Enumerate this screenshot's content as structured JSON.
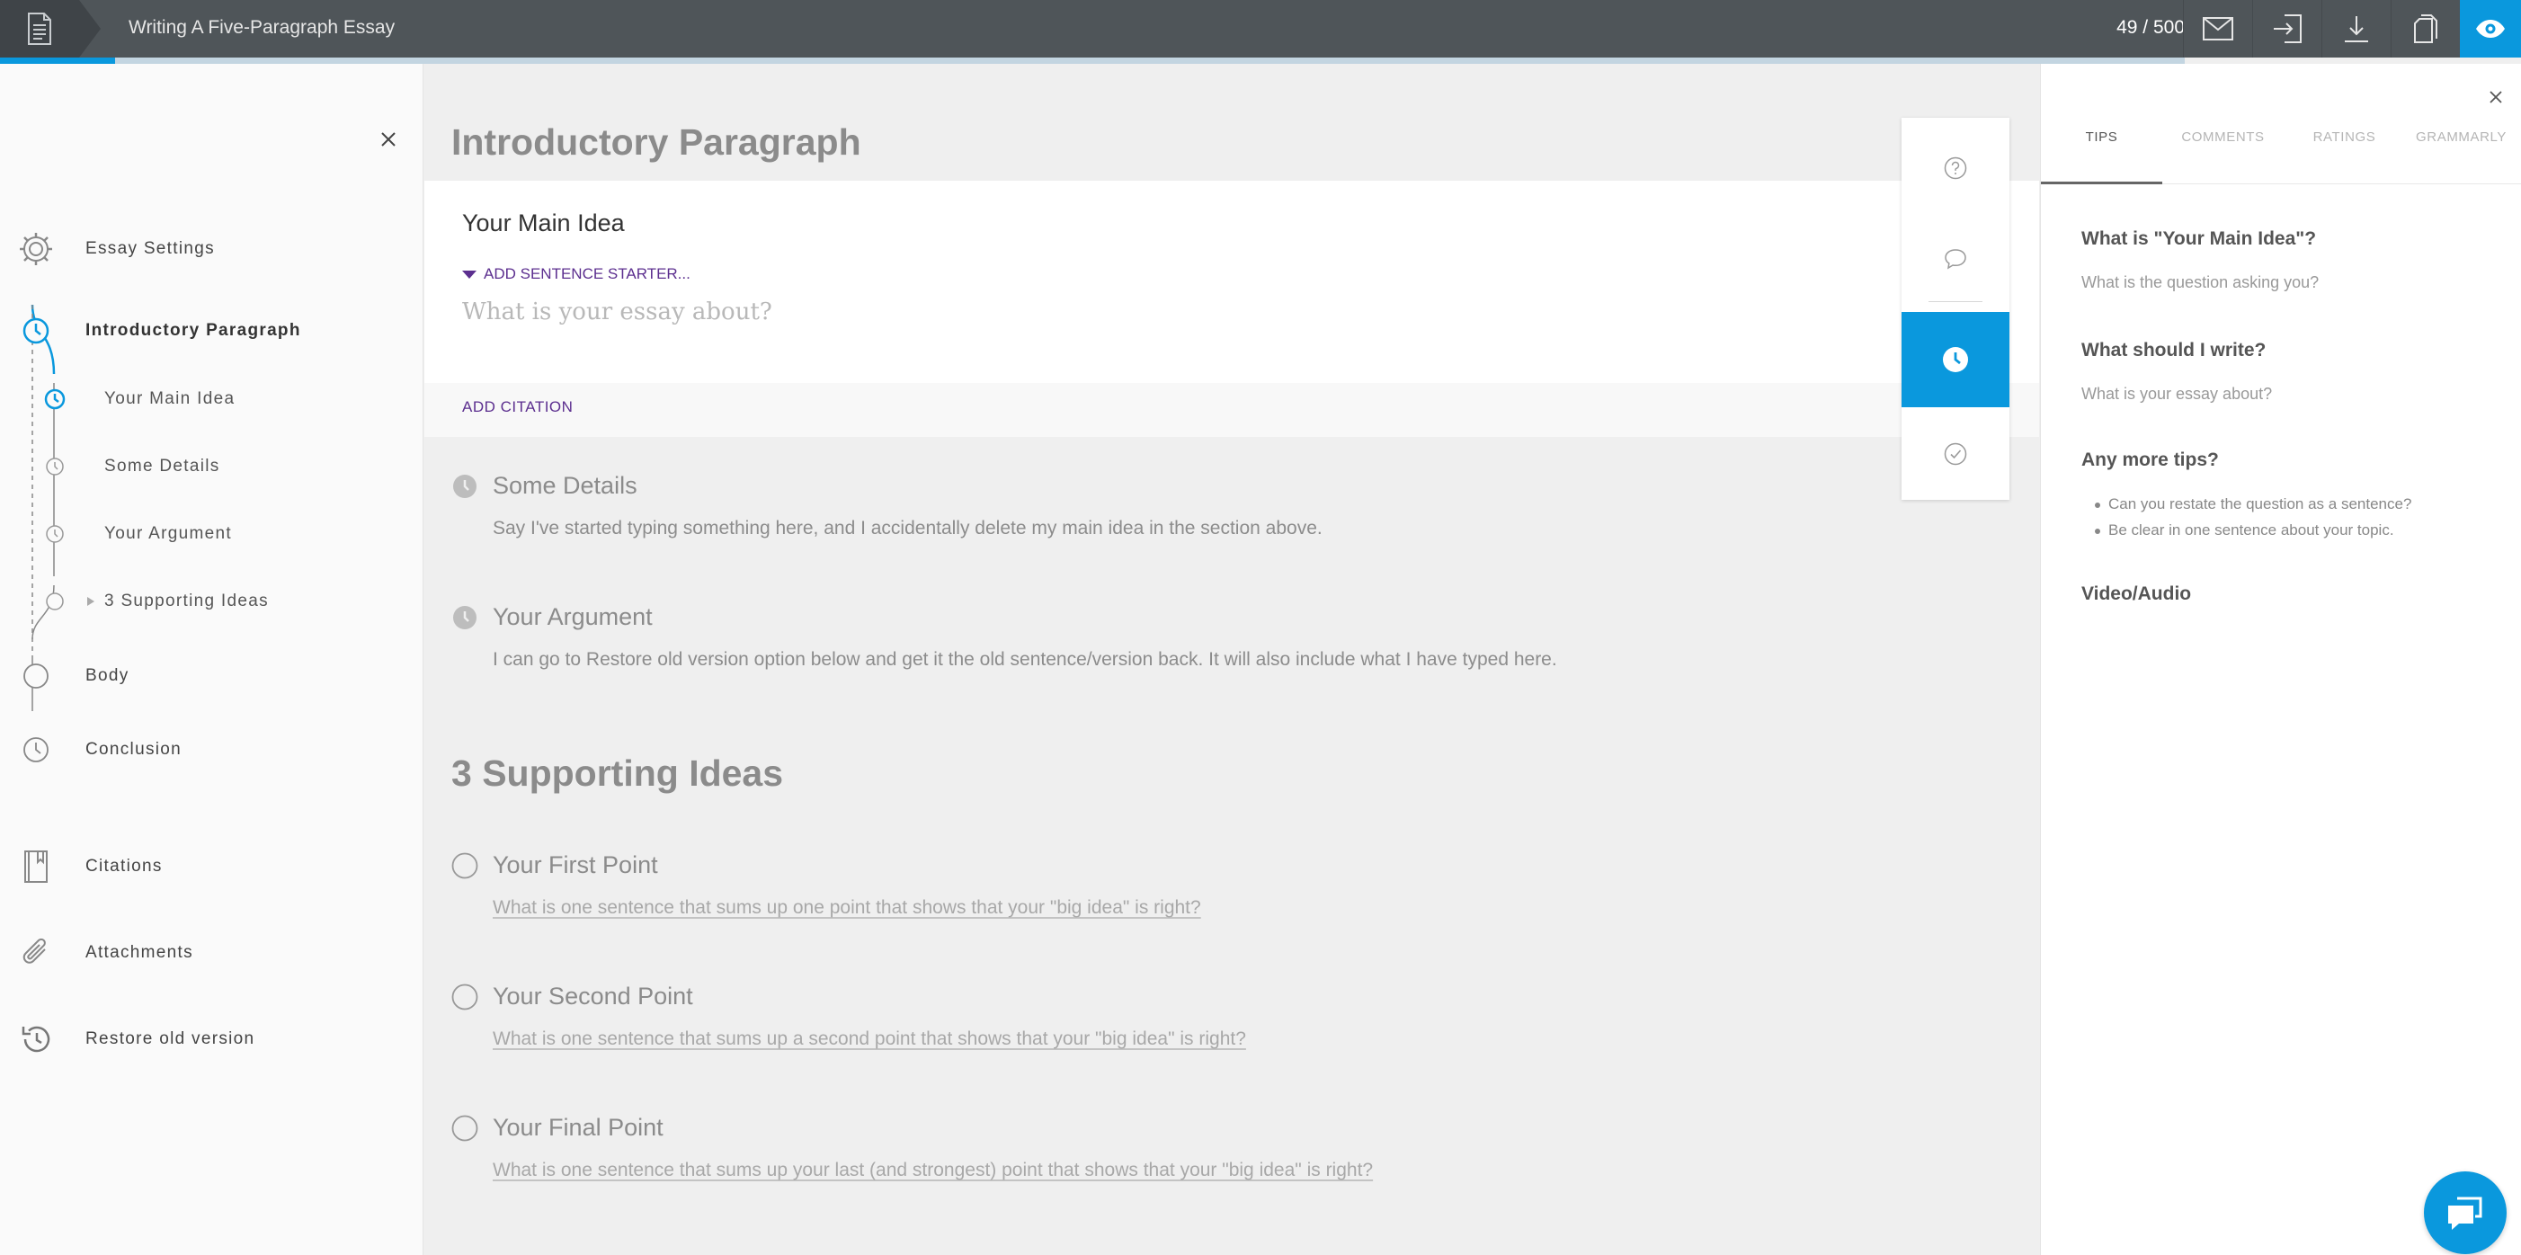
{
  "topbar": {
    "document_icon": "document-icon",
    "title": "Writing A Five-Paragraph Essay",
    "word_count": "49 / 500",
    "progress_fraction": 0.0527,
    "actions": [
      {
        "icon": "mail-icon"
      },
      {
        "icon": "import-icon"
      },
      {
        "icon": "download-icon"
      },
      {
        "icon": "copy-icon"
      },
      {
        "icon": "eye-icon"
      }
    ],
    "accent_color": "#0a98dd"
  },
  "sidebar": {
    "items": [
      {
        "label": "Essay Settings",
        "icon": "gear-icon"
      },
      {
        "label": "Introductory Paragraph",
        "icon": "clock-icon"
      },
      {
        "label": "Your Main Idea",
        "icon": "clock-icon"
      },
      {
        "label": "Some Details",
        "icon": "clock-icon"
      },
      {
        "label": "Your Argument",
        "icon": "clock-icon"
      },
      {
        "label": "3 Supporting Ideas",
        "icon": "circle-icon"
      },
      {
        "label": "Body",
        "icon": "circle-icon"
      },
      {
        "label": "Conclusion",
        "icon": "clock-icon"
      },
      {
        "label": "Citations",
        "icon": "book-icon"
      },
      {
        "label": "Attachments",
        "icon": "paperclip-icon"
      },
      {
        "label": "Restore old version",
        "icon": "history-icon"
      }
    ]
  },
  "main": {
    "section_title": "Introductory Paragraph",
    "active_question": {
      "title": "Your Main Idea",
      "starter_label": "ADD SENTENCE STARTER...",
      "placeholder": "What is your essay about?",
      "citation_label": "ADD CITATION"
    },
    "questions": [
      {
        "title": "Some Details",
        "text": "Say I've started typing something here, and I accidentally delete my main idea in the section above."
      },
      {
        "title": "Your Argument",
        "text": "I can go to Restore old version option below and get it the old sentence/version back. It will also include what I have typed here."
      }
    ],
    "section2_title": "3 Supporting Ideas",
    "points": [
      {
        "title": "Your First Point",
        "text": "What is one sentence that sums up one point that shows that your \"big idea\" is right?"
      },
      {
        "title": "Your Second Point",
        "text": "What is one sentence that sums up a second point that shows that your \"big idea\" is right?"
      },
      {
        "title": "Your Final Point",
        "text": "What is one sentence that sums up your last (and strongest) point that shows that your \"big idea\" is right?"
      }
    ],
    "float_toolbar": [
      {
        "icon": "help-icon"
      },
      {
        "icon": "comment-icon"
      },
      {
        "icon": "clock-icon"
      },
      {
        "icon": "check-circle-icon"
      }
    ]
  },
  "rpanel": {
    "tabs": [
      "TIPS",
      "COMMENTS",
      "RATINGS",
      "GRAMMARLY"
    ],
    "active_tab": "TIPS",
    "q1": "What is \"Your Main Idea\"?",
    "a1": "What is the question asking you?",
    "q2": "What should I write?",
    "a2": "What is your essay about?",
    "q3": "Any more tips?",
    "tips": [
      "Can you restate the question as a sentence?",
      "Be clear in one sentence about your topic."
    ],
    "q4": "Video/Audio"
  },
  "chat": {
    "icon": "chat-icon"
  }
}
